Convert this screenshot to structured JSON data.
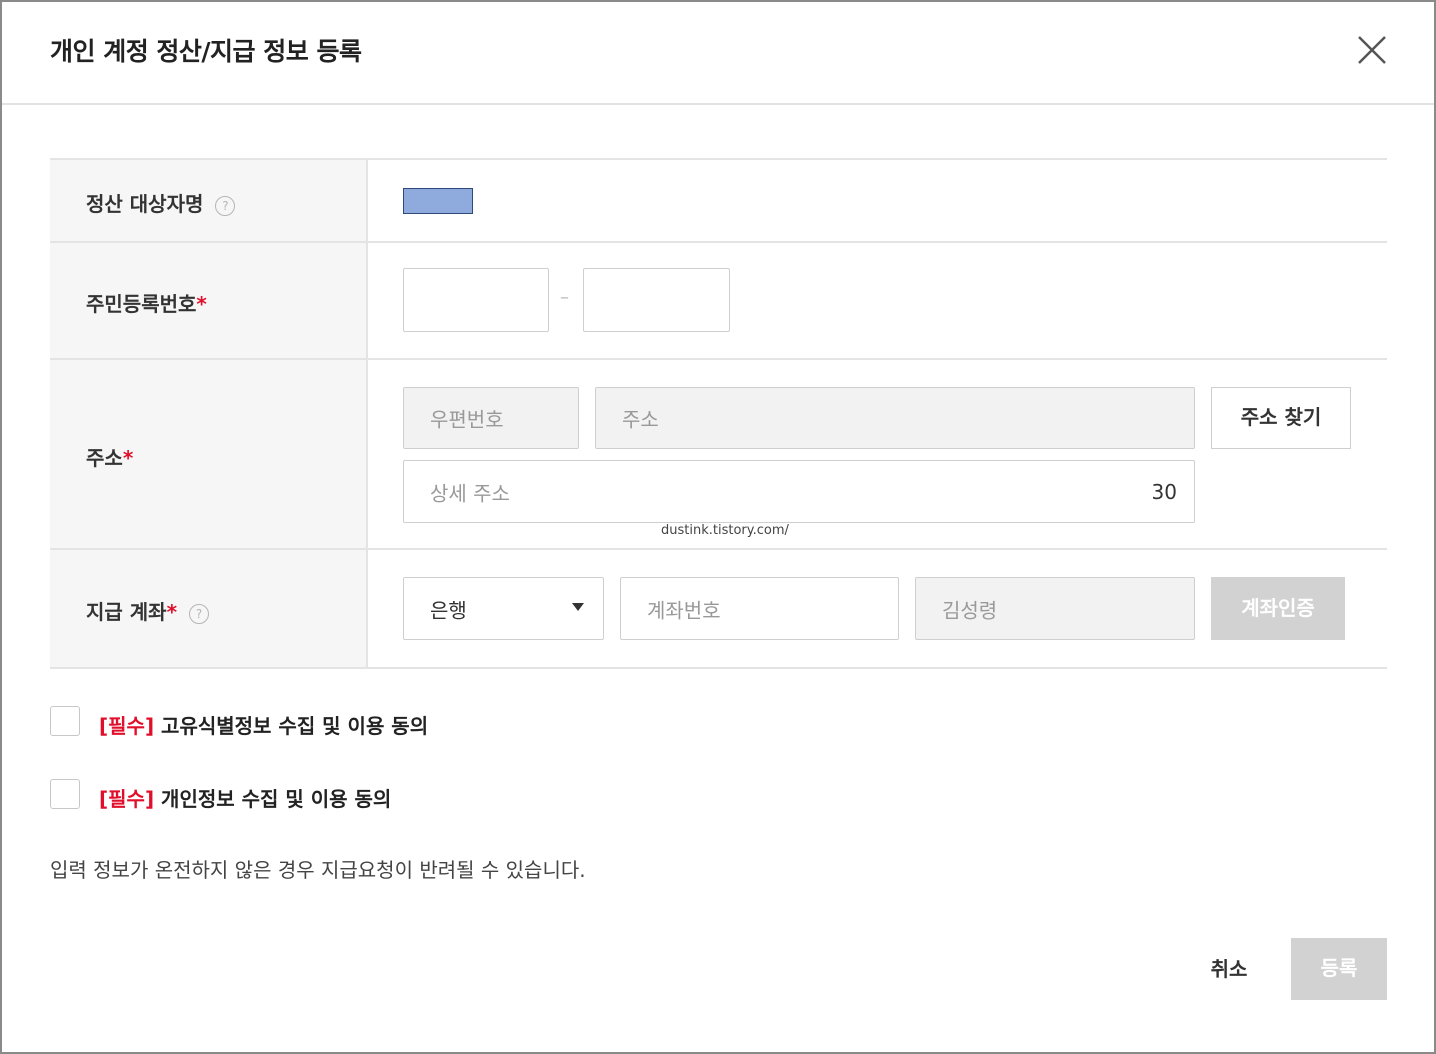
{
  "dialog": {
    "title": "개인 계정 정산/지급 정보 등록",
    "close_icon": "close-icon"
  },
  "form": {
    "recipient": {
      "label": "정산 대상자명",
      "help_icon": "help-icon",
      "help_glyph": "?",
      "value_masked": true,
      "mask_color": "#8faadc"
    },
    "resident_number": {
      "label": "주민등록번호",
      "required_mark": "*",
      "separator": "–",
      "first_value": "",
      "second_value": ""
    },
    "address": {
      "label": "주소",
      "required_mark": "*",
      "postal_placeholder": "우편번호",
      "address_placeholder": "주소",
      "find_button": "주소 찾기",
      "detail_placeholder": "상세 주소",
      "detail_char_count": "30"
    },
    "account": {
      "label": "지급 계좌",
      "required_mark": "*",
      "help_icon": "help-icon",
      "help_glyph": "?",
      "bank_selected": "은행",
      "account_placeholder": "계좌번호",
      "holder_placeholder": "김성령",
      "verify_button": "계좌인증"
    }
  },
  "watermark": "dustink.tistory.com/",
  "agreements": [
    {
      "tag": "[필수]",
      "text": " 고유식별정보 수집 및 이용 동의",
      "checked": false
    },
    {
      "tag": "[필수]",
      "text": " 개인정보 수집 및 이용 동의",
      "checked": false
    }
  ],
  "notice": "입력 정보가 온전하지 않은 경우 지급요청이 반려될 수 있습니다.",
  "footer": {
    "cancel_label": "취소",
    "submit_label": "등록"
  },
  "colors": {
    "required": "#e0102c",
    "disabled_button": "#d2d2d2"
  }
}
